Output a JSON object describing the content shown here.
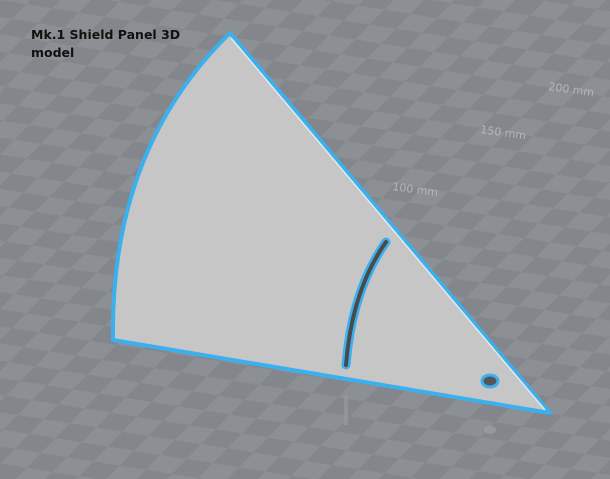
{
  "caption": "Mk.1 Shield Panel 3D model",
  "grid_labels": [
    "100 mm",
    "150 mm",
    "200 mm"
  ],
  "colors": {
    "background": "#8b8e92",
    "model": "#c4c4c4",
    "outline": "#3ab0ef"
  }
}
